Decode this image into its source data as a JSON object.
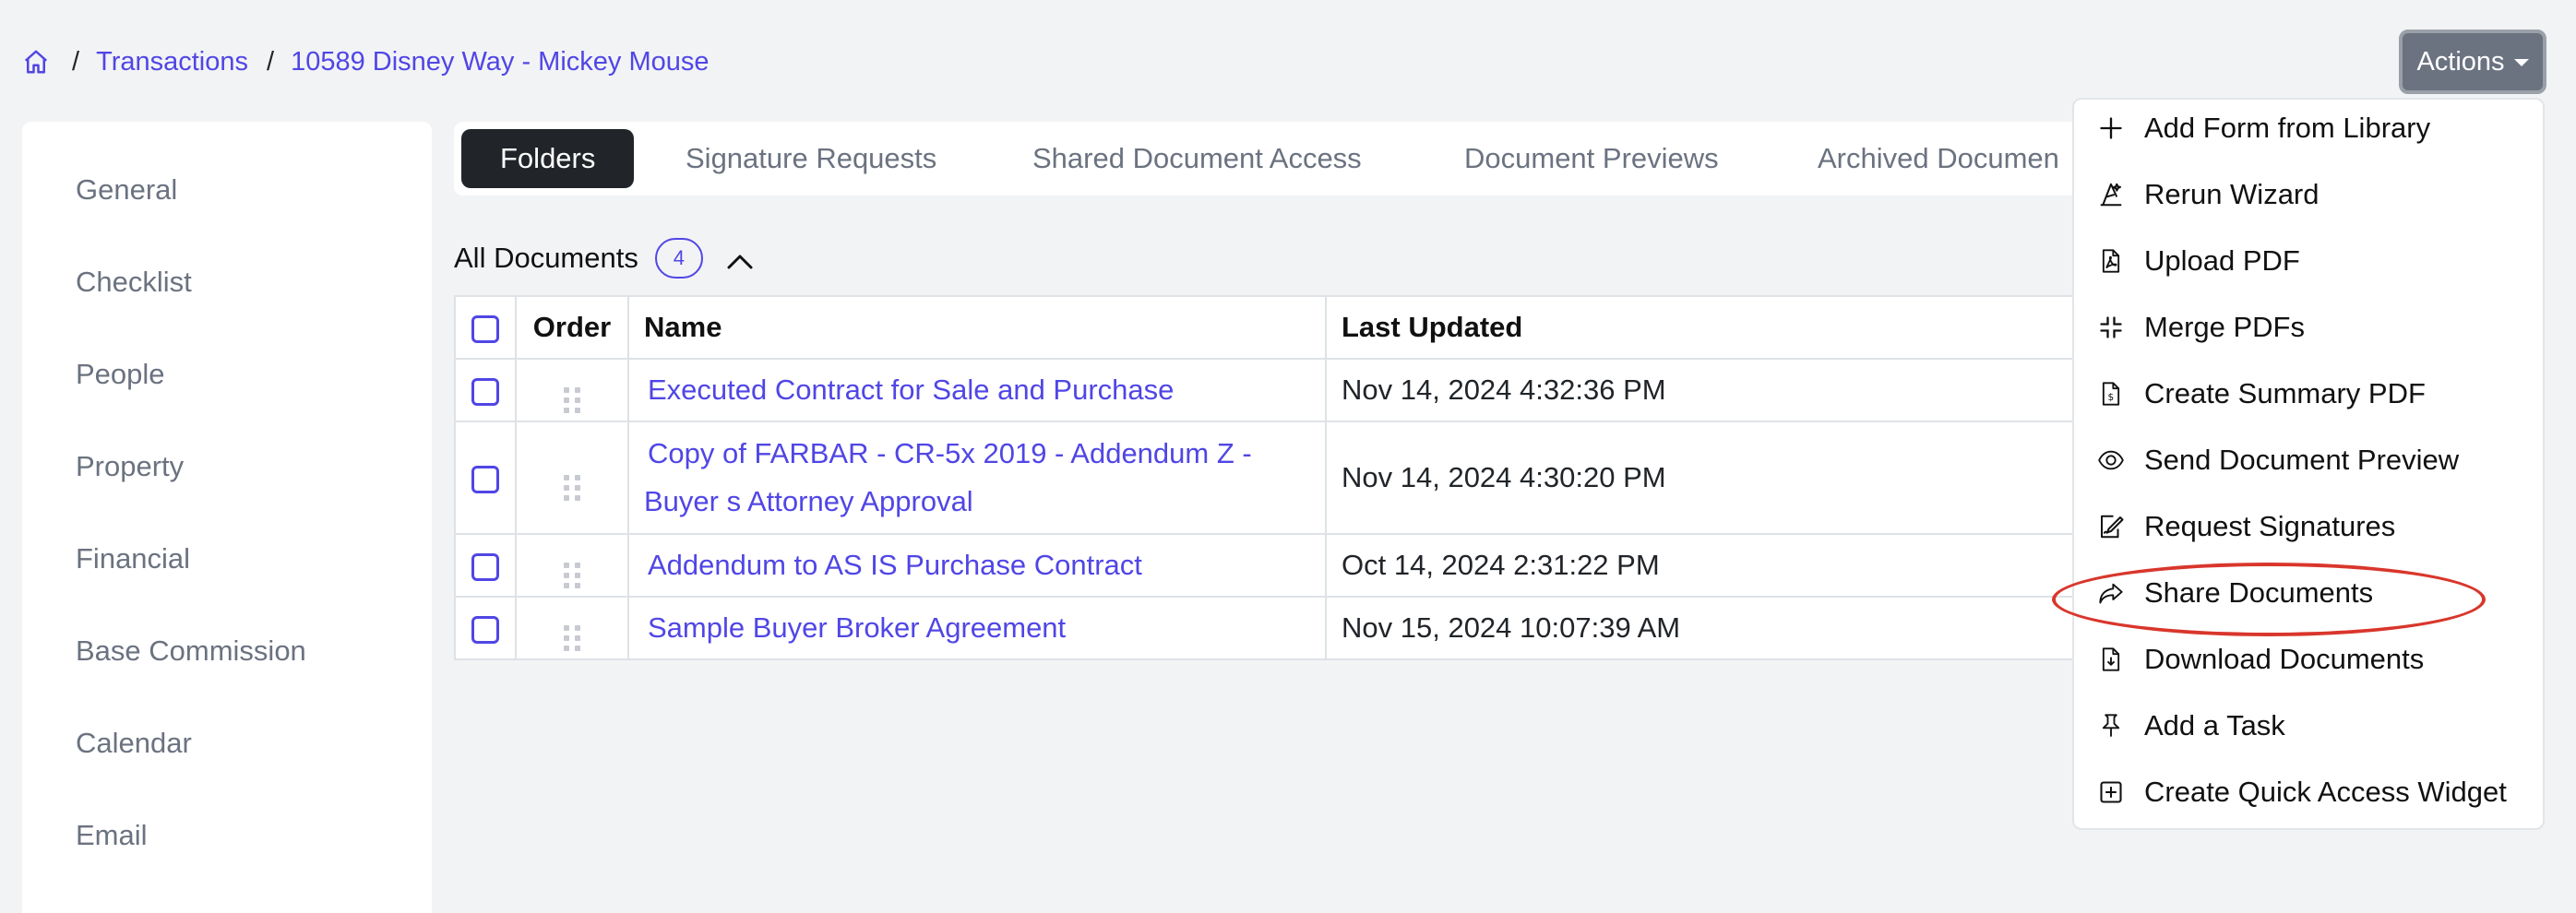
{
  "breadcrumb": {
    "home_icon": "home-icon",
    "separator": "/",
    "items": [
      "Transactions",
      "10589 Disney Way - Mickey Mouse"
    ]
  },
  "actions_button": {
    "label": "Actions"
  },
  "sidebar": {
    "items": [
      "General",
      "Checklist",
      "People",
      "Property",
      "Financial",
      "Base Commission",
      "Calendar",
      "Email"
    ]
  },
  "tabs": [
    "Folders",
    "Signature Requests",
    "Shared Document Access",
    "Document Previews",
    "Archived Documen"
  ],
  "documents": {
    "header": "All Documents",
    "count": "4",
    "columns": {
      "order": "Order",
      "name": "Name",
      "last_updated": "Last Updated"
    },
    "rows": [
      {
        "name": "Executed Contract for Sale and Purchase",
        "updated": "Nov 14, 2024 4:32:36 PM"
      },
      {
        "name_line1": "Copy of FARBAR - CR-5x 2019 - Addendum Z -",
        "name_line2": "Buyer s Attorney Approval",
        "updated": "Nov 14, 2024 4:30:20 PM"
      },
      {
        "name": "Addendum to AS IS Purchase Contract",
        "updated": "Oct 14, 2024 2:31:22 PM"
      },
      {
        "name": "Sample Buyer Broker Agreement",
        "updated": "Nov 15, 2024 10:07:39 AM"
      }
    ]
  },
  "actions_menu": {
    "items": [
      {
        "label": "Add Form from Library",
        "icon": "plus-icon"
      },
      {
        "label": "Rerun Wizard",
        "icon": "wizard-hat-icon"
      },
      {
        "label": "Upload PDF",
        "icon": "pdf-file-icon"
      },
      {
        "label": "Merge PDFs",
        "icon": "merge-icon"
      },
      {
        "label": "Create Summary PDF",
        "icon": "summary-file-icon"
      },
      {
        "label": "Send Document Preview",
        "icon": "eye-icon"
      },
      {
        "label": "Request Signatures",
        "icon": "signature-icon"
      },
      {
        "label": "Share Documents",
        "icon": "share-icon"
      },
      {
        "label": "Download Documents",
        "icon": "download-file-icon"
      },
      {
        "label": "Add a Task",
        "icon": "pin-icon"
      },
      {
        "label": "Create Quick Access Widget",
        "icon": "plus-square-icon"
      }
    ]
  },
  "colors": {
    "link": "#5046e5",
    "highlight": "#d9362c",
    "active_tab": "#212529"
  }
}
